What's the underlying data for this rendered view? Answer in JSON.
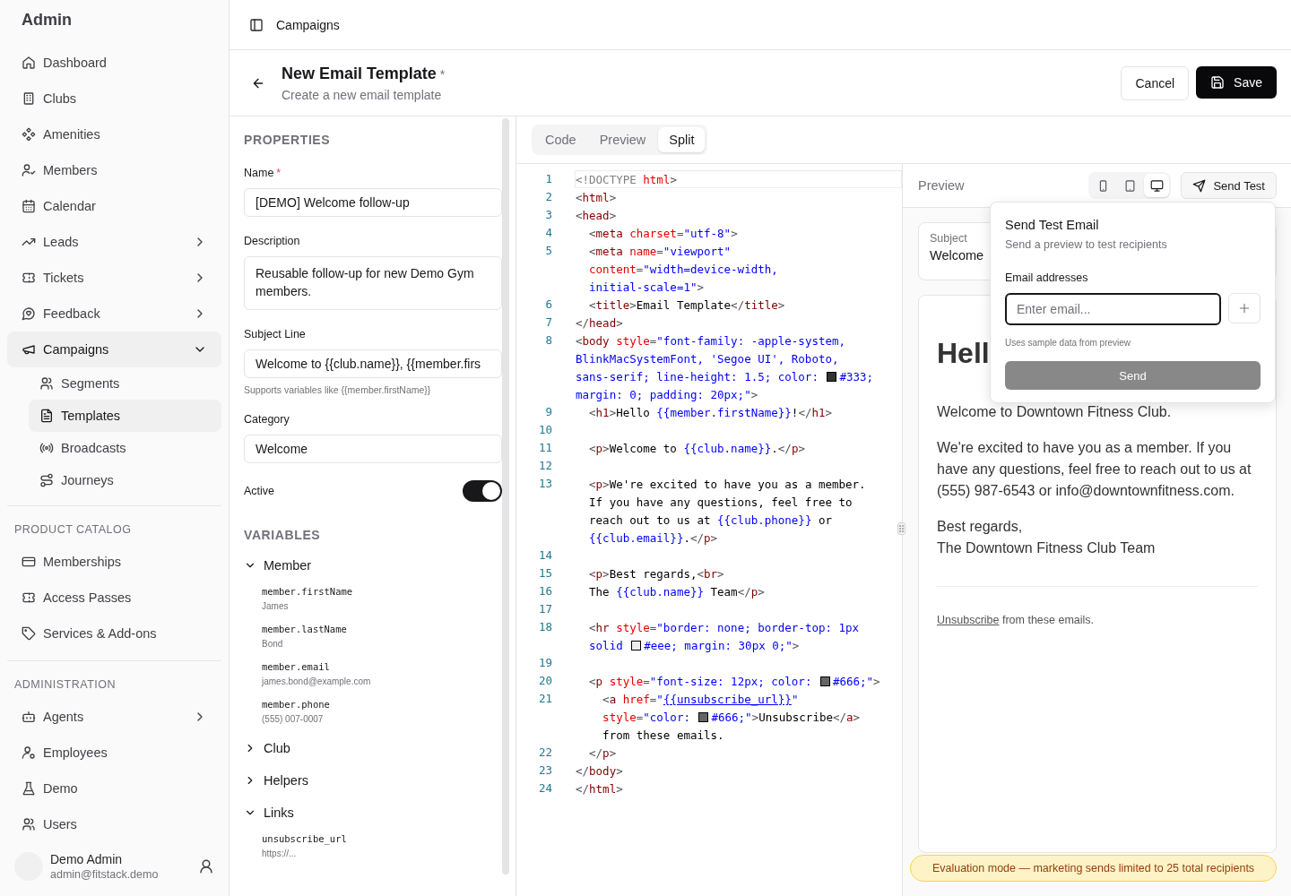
{
  "sidebar": {
    "title": "Admin",
    "nav": [
      {
        "kind": "link",
        "label": "Dashboard"
      },
      {
        "kind": "link",
        "label": "Clubs"
      },
      {
        "kind": "link",
        "label": "Amenities"
      },
      {
        "kind": "link",
        "label": "Members"
      },
      {
        "kind": "link",
        "label": "Calendar"
      },
      {
        "kind": "group",
        "label": "Leads",
        "expanded": false
      },
      {
        "kind": "group",
        "label": "Tickets",
        "expanded": false
      },
      {
        "kind": "group",
        "label": "Feedback",
        "expanded": false
      },
      {
        "kind": "group",
        "label": "Campaigns",
        "expanded": true,
        "children": [
          {
            "label": "Segments",
            "selected": false
          },
          {
            "label": "Templates",
            "selected": true
          },
          {
            "label": "Broadcasts",
            "selected": false
          },
          {
            "label": "Journeys",
            "selected": false
          }
        ]
      }
    ],
    "sections": [
      {
        "heading": "PRODUCT CATALOG",
        "items": [
          {
            "kind": "link",
            "label": "Memberships"
          },
          {
            "kind": "link",
            "label": "Access Passes"
          },
          {
            "kind": "link",
            "label": "Services & Add-ons"
          }
        ]
      },
      {
        "heading": "ADMINISTRATION",
        "items": [
          {
            "kind": "group",
            "label": "Agents",
            "expanded": false
          },
          {
            "kind": "link",
            "label": "Employees"
          },
          {
            "kind": "link",
            "label": "Demo"
          },
          {
            "kind": "link",
            "label": "Users"
          }
        ]
      }
    ],
    "user": {
      "name": "Demo Admin",
      "email": "admin@fitstack.demo"
    }
  },
  "breadcrumb": "Campaigns",
  "header": {
    "title": "New Email Template",
    "unsaved_mark": "*",
    "subtitle": "Create a new email template",
    "buttons": [
      {
        "kind": "secondary",
        "label": "Cancel"
      },
      {
        "kind": "primary",
        "label": "Save"
      }
    ]
  },
  "properties": {
    "heading": "PROPERTIES",
    "fields": [
      {
        "kind": "input",
        "label": "Name",
        "required_mark": "*",
        "value": "[DEMO] Welcome follow-up"
      },
      {
        "kind": "textarea",
        "label": "Description",
        "value": "Reusable follow-up for new Demo Gym members."
      },
      {
        "kind": "input",
        "label": "Subject Line",
        "value": "Welcome to {{club.name}}, {{member.firs",
        "hint": "Supports variables like {{member.firstName}}"
      },
      {
        "kind": "input",
        "label": "Category",
        "value": "Welcome"
      },
      {
        "kind": "toggle",
        "label": "Active",
        "on": true
      }
    ],
    "variables": {
      "heading": "VARIABLES",
      "groups": [
        {
          "label": "Member",
          "expanded": true,
          "children": [
            {
              "name": "member.firstName",
              "sample": "James"
            },
            {
              "name": "member.lastName",
              "sample": "Bond"
            },
            {
              "name": "member.email",
              "sample": "james.bond@example.com"
            },
            {
              "name": "member.phone",
              "sample": "(555) 007-0007"
            }
          ]
        },
        {
          "label": "Club",
          "expanded": false
        },
        {
          "label": "Helpers",
          "expanded": false
        },
        {
          "label": "Links",
          "expanded": true,
          "children": [
            {
              "name": "unsubscribe_url",
              "sample": "https://..."
            }
          ]
        }
      ]
    }
  },
  "editor": {
    "tabs": [
      {
        "label": "Code",
        "selected": false
      },
      {
        "label": "Preview",
        "selected": false
      },
      {
        "label": "Split",
        "selected": true
      }
    ],
    "code": [
      {
        "number": "1",
        "current": true,
        "tokens": [
          {
            "kind": "doctype",
            "text": "<!DOCTYPE "
          },
          {
            "kind": "attr",
            "text": "html"
          },
          {
            "kind": "punct",
            "text": ">"
          }
        ]
      },
      {
        "number": "2",
        "current": false,
        "tokens": [
          {
            "kind": "punct",
            "text": "<"
          },
          {
            "kind": "tag",
            "text": "html"
          },
          {
            "kind": "punct",
            "text": ">"
          }
        ]
      },
      {
        "number": "3",
        "current": false,
        "tokens": [
          {
            "kind": "punct",
            "text": "<"
          },
          {
            "kind": "tag",
            "text": "head"
          },
          {
            "kind": "punct",
            "text": ">"
          }
        ]
      },
      {
        "number": "4",
        "current": false,
        "tokens": [
          {
            "kind": "punct",
            "text": "  <"
          },
          {
            "kind": "tag",
            "text": "meta"
          },
          {
            "kind": "attr",
            "text": " charset"
          },
          {
            "kind": "punct",
            "text": "="
          },
          {
            "kind": "string",
            "text": "\"utf-8\""
          },
          {
            "kind": "punct",
            "text": ">"
          }
        ]
      },
      {
        "number": "5",
        "current": false,
        "tokens": [
          {
            "kind": "punct",
            "text": "  <"
          },
          {
            "kind": "tag",
            "text": "meta"
          },
          {
            "kind": "attr",
            "text": " name"
          },
          {
            "kind": "punct",
            "text": "="
          },
          {
            "kind": "string",
            "text": "\"viewport\""
          }
        ]
      },
      {
        "current": false,
        "tokens": [
          {
            "kind": "attr",
            "text": "  content"
          },
          {
            "kind": "punct",
            "text": "="
          },
          {
            "kind": "string",
            "text": "\"width=device-width,"
          }
        ]
      },
      {
        "current": false,
        "tokens": [
          {
            "kind": "string",
            "text": "  initial-scale=1\""
          },
          {
            "kind": "punct",
            "text": ">"
          }
        ]
      },
      {
        "number": "6",
        "current": false,
        "tokens": [
          {
            "kind": "punct",
            "text": "  <"
          },
          {
            "kind": "tag",
            "text": "title"
          },
          {
            "kind": "punct",
            "text": ">"
          },
          {
            "kind": "text",
            "text": "Email Template"
          },
          {
            "kind": "punct",
            "text": "</"
          },
          {
            "kind": "tag",
            "text": "title"
          },
          {
            "kind": "punct",
            "text": ">"
          }
        ]
      },
      {
        "number": "7",
        "current": false,
        "tokens": [
          {
            "kind": "punct",
            "text": "</"
          },
          {
            "kind": "tag",
            "text": "head"
          },
          {
            "kind": "punct",
            "text": ">"
          }
        ]
      },
      {
        "number": "8",
        "current": false,
        "tokens": [
          {
            "kind": "punct",
            "text": "<"
          },
          {
            "kind": "tag",
            "text": "body"
          },
          {
            "kind": "attr",
            "text": " style"
          },
          {
            "kind": "punct",
            "text": "="
          },
          {
            "kind": "string",
            "text": "\"font-family: -apple-system,"
          }
        ]
      },
      {
        "current": false,
        "tokens": [
          {
            "kind": "string",
            "text": "BlinkMacSystemFont, 'Segoe UI', Roboto,"
          }
        ]
      },
      {
        "current": false,
        "tokens": [
          {
            "kind": "string",
            "text": "sans-serif; line-height: 1.5; color: "
          },
          {
            "kind": "swatch",
            "color": "#333333"
          },
          {
            "kind": "string",
            "text": "#333;"
          }
        ]
      },
      {
        "current": false,
        "tokens": [
          {
            "kind": "string",
            "text": "margin: 0; padding: 20px;\""
          },
          {
            "kind": "punct",
            "text": ">"
          }
        ]
      },
      {
        "number": "9",
        "current": false,
        "tokens": [
          {
            "kind": "punct",
            "text": "  <"
          },
          {
            "kind": "tag",
            "text": "h1"
          },
          {
            "kind": "punct",
            "text": ">"
          },
          {
            "kind": "text",
            "text": "Hello "
          },
          {
            "kind": "var",
            "text": "{{member.firstName}}"
          },
          {
            "kind": "text",
            "text": "!"
          },
          {
            "kind": "punct",
            "text": "</"
          },
          {
            "kind": "tag",
            "text": "h1"
          },
          {
            "kind": "punct",
            "text": ">"
          }
        ]
      },
      {
        "number": "10",
        "current": false
      },
      {
        "number": "11",
        "current": false,
        "tokens": [
          {
            "kind": "punct",
            "text": "  <"
          },
          {
            "kind": "tag",
            "text": "p"
          },
          {
            "kind": "punct",
            "text": ">"
          },
          {
            "kind": "text",
            "text": "Welcome to "
          },
          {
            "kind": "var",
            "text": "{{club.name}}"
          },
          {
            "kind": "text",
            "text": "."
          },
          {
            "kind": "punct",
            "text": "</"
          },
          {
            "kind": "tag",
            "text": "p"
          },
          {
            "kind": "punct",
            "text": ">"
          }
        ]
      },
      {
        "number": "12",
        "current": false
      },
      {
        "number": "13",
        "current": false,
        "tokens": [
          {
            "kind": "punct",
            "text": "  <"
          },
          {
            "kind": "tag",
            "text": "p"
          },
          {
            "kind": "punct",
            "text": ">"
          },
          {
            "kind": "text",
            "text": "We're excited to have you as a member."
          }
        ]
      },
      {
        "current": false,
        "tokens": [
          {
            "kind": "text",
            "text": "  If you have any questions, feel free to"
          }
        ]
      },
      {
        "current": false,
        "tokens": [
          {
            "kind": "text",
            "text": "  reach out to us at "
          },
          {
            "kind": "var",
            "text": "{{club.phone}}"
          },
          {
            "kind": "text",
            "text": " or"
          }
        ]
      },
      {
        "current": false,
        "tokens": [
          {
            "kind": "var",
            "text": "  {{club.email}}"
          },
          {
            "kind": "text",
            "text": "."
          },
          {
            "kind": "punct",
            "text": "</"
          },
          {
            "kind": "tag",
            "text": "p"
          },
          {
            "kind": "punct",
            "text": ">"
          }
        ]
      },
      {
        "number": "14",
        "current": false
      },
      {
        "number": "15",
        "current": false,
        "tokens": [
          {
            "kind": "punct",
            "text": "  <"
          },
          {
            "kind": "tag",
            "text": "p"
          },
          {
            "kind": "punct",
            "text": ">"
          },
          {
            "kind": "text",
            "text": "Best regards,"
          },
          {
            "kind": "punct",
            "text": "<"
          },
          {
            "kind": "tag",
            "text": "br"
          },
          {
            "kind": "punct",
            "text": ">"
          }
        ]
      },
      {
        "number": "16",
        "current": false,
        "tokens": [
          {
            "kind": "text",
            "text": "  The "
          },
          {
            "kind": "var",
            "text": "{{club.name}}"
          },
          {
            "kind": "text",
            "text": " Team"
          },
          {
            "kind": "punct",
            "text": "</"
          },
          {
            "kind": "tag",
            "text": "p"
          },
          {
            "kind": "punct",
            "text": ">"
          }
        ]
      },
      {
        "number": "17",
        "current": false
      },
      {
        "number": "18",
        "current": false,
        "tokens": [
          {
            "kind": "punct",
            "text": "  <"
          },
          {
            "kind": "tag",
            "text": "hr"
          },
          {
            "kind": "attr",
            "text": " style"
          },
          {
            "kind": "punct",
            "text": "="
          },
          {
            "kind": "string",
            "text": "\"border: none; border-top: 1px"
          }
        ]
      },
      {
        "current": false,
        "tokens": [
          {
            "kind": "string",
            "text": "  solid "
          },
          {
            "kind": "swatch",
            "color": "#eeeeee"
          },
          {
            "kind": "string",
            "text": "#eee; margin: 30px 0;\""
          },
          {
            "kind": "punct",
            "text": ">"
          }
        ]
      },
      {
        "number": "19",
        "current": false
      },
      {
        "number": "20",
        "current": false,
        "tokens": [
          {
            "kind": "punct",
            "text": "  <"
          },
          {
            "kind": "tag",
            "text": "p"
          },
          {
            "kind": "attr",
            "text": " style"
          },
          {
            "kind": "punct",
            "text": "="
          },
          {
            "kind": "string",
            "text": "\"font-size: 12px; color: "
          },
          {
            "kind": "swatch",
            "color": "#666666"
          },
          {
            "kind": "string",
            "text": "#666;\""
          },
          {
            "kind": "punct",
            "text": ">"
          }
        ]
      },
      {
        "number": "21",
        "current": false,
        "tokens": [
          {
            "kind": "punct",
            "text": "    <"
          },
          {
            "kind": "tag",
            "text": "a"
          },
          {
            "kind": "attr",
            "text": " href"
          },
          {
            "kind": "punct",
            "text": "="
          },
          {
            "kind": "string",
            "text": "\""
          },
          {
            "kind": "link",
            "text": "{{unsubscribe_url}}"
          },
          {
            "kind": "string",
            "text": "\""
          }
        ]
      },
      {
        "current": false,
        "tokens": [
          {
            "kind": "attr",
            "text": "    style"
          },
          {
            "kind": "punct",
            "text": "="
          },
          {
            "kind": "string",
            "text": "\"color: "
          },
          {
            "kind": "swatch",
            "color": "#666666"
          },
          {
            "kind": "string",
            "text": "#666;\""
          },
          {
            "kind": "punct",
            "text": ">"
          },
          {
            "kind": "text",
            "text": "Unsubscribe"
          },
          {
            "kind": "punct",
            "text": "</"
          },
          {
            "kind": "tag",
            "text": "a"
          },
          {
            "kind": "punct",
            "text": ">"
          }
        ]
      },
      {
        "current": false,
        "tokens": [
          {
            "kind": "text",
            "text": "    from these emails."
          }
        ]
      },
      {
        "number": "22",
        "current": false,
        "tokens": [
          {
            "kind": "punct",
            "text": "  </"
          },
          {
            "kind": "tag",
            "text": "p"
          },
          {
            "kind": "punct",
            "text": ">"
          }
        ]
      },
      {
        "number": "23",
        "current": false,
        "tokens": [
          {
            "kind": "punct",
            "text": "</"
          },
          {
            "kind": "tag",
            "text": "body"
          },
          {
            "kind": "punct",
            "text": ">"
          }
        ]
      },
      {
        "number": "24",
        "current": false,
        "tokens": [
          {
            "kind": "punct",
            "text": "</"
          },
          {
            "kind": "tag",
            "text": "html"
          },
          {
            "kind": "punct",
            "text": ">"
          }
        ]
      }
    ]
  },
  "preview": {
    "title": "Preview",
    "devices": [
      {
        "selected": false
      },
      {
        "selected": false
      },
      {
        "selected": true
      }
    ],
    "send_test": "Send Test",
    "subject_label": "Subject",
    "subject": "Welcome",
    "email": {
      "heading": "Hell",
      "paragraphs": [
        "Welcome to Downtown Fitness Club.",
        "We're excited to have you as a member. If you have any questions, feel free to reach out to us at (555) 987-6543 or info@downtownfitness.com."
      ],
      "signature": [
        "Best regards,",
        "The Downtown Fitness Club Team"
      ],
      "footer_link": "Unsubscribe",
      "footer_text": "from these emails."
    },
    "popover": {
      "title": "Send Test Email",
      "subtitle": "Send a preview to test recipients",
      "field_label": "Email addresses",
      "placeholder": "Enter email...",
      "hint": "Uses sample data from preview",
      "send": "Send",
      "send_disabled": true
    },
    "banner": "Evaluation mode — marketing sends limited to 25 total recipients"
  }
}
